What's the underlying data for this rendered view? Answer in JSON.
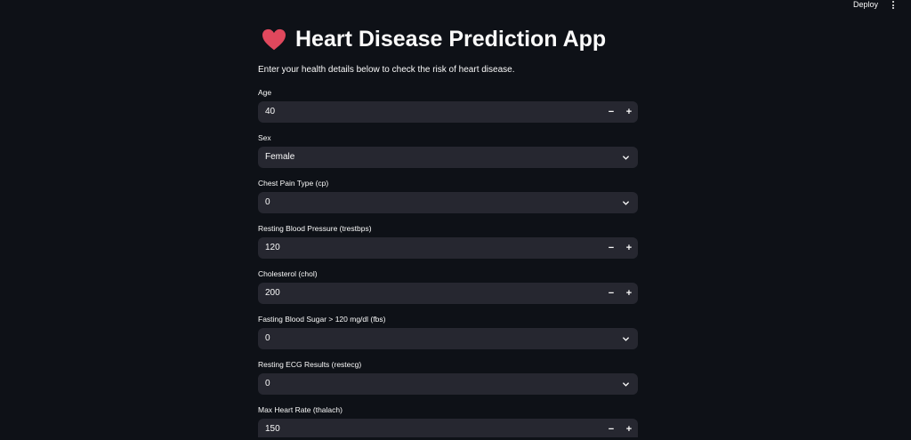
{
  "toolbar": {
    "deploy_label": "Deploy",
    "menu_icon": "vertical-dots-icon"
  },
  "header": {
    "icon": "heart-icon",
    "title": "Heart Disease Prediction App",
    "subtitle": "Enter your health details below to check the risk of heart disease."
  },
  "form": {
    "age": {
      "label": "Age",
      "value": "40"
    },
    "sex": {
      "label": "Sex",
      "value": "Female"
    },
    "cp": {
      "label": "Chest Pain Type (cp)",
      "value": "0"
    },
    "trestbps": {
      "label": "Resting Blood Pressure (trestbps)",
      "value": "120"
    },
    "chol": {
      "label": "Cholesterol (chol)",
      "value": "200"
    },
    "fbs": {
      "label": "Fasting Blood Sugar > 120 mg/dl (fbs)",
      "value": "0"
    },
    "restecg": {
      "label": "Resting ECG Results (restecg)",
      "value": "0"
    },
    "thalach": {
      "label": "Max Heart Rate (thalach)",
      "value": "150"
    },
    "minus_symbol": "−",
    "plus_symbol": "+"
  },
  "colors": {
    "background": "#0e1117",
    "input_background": "#262730",
    "heart": "#e0485d",
    "text": "#fafafa"
  }
}
